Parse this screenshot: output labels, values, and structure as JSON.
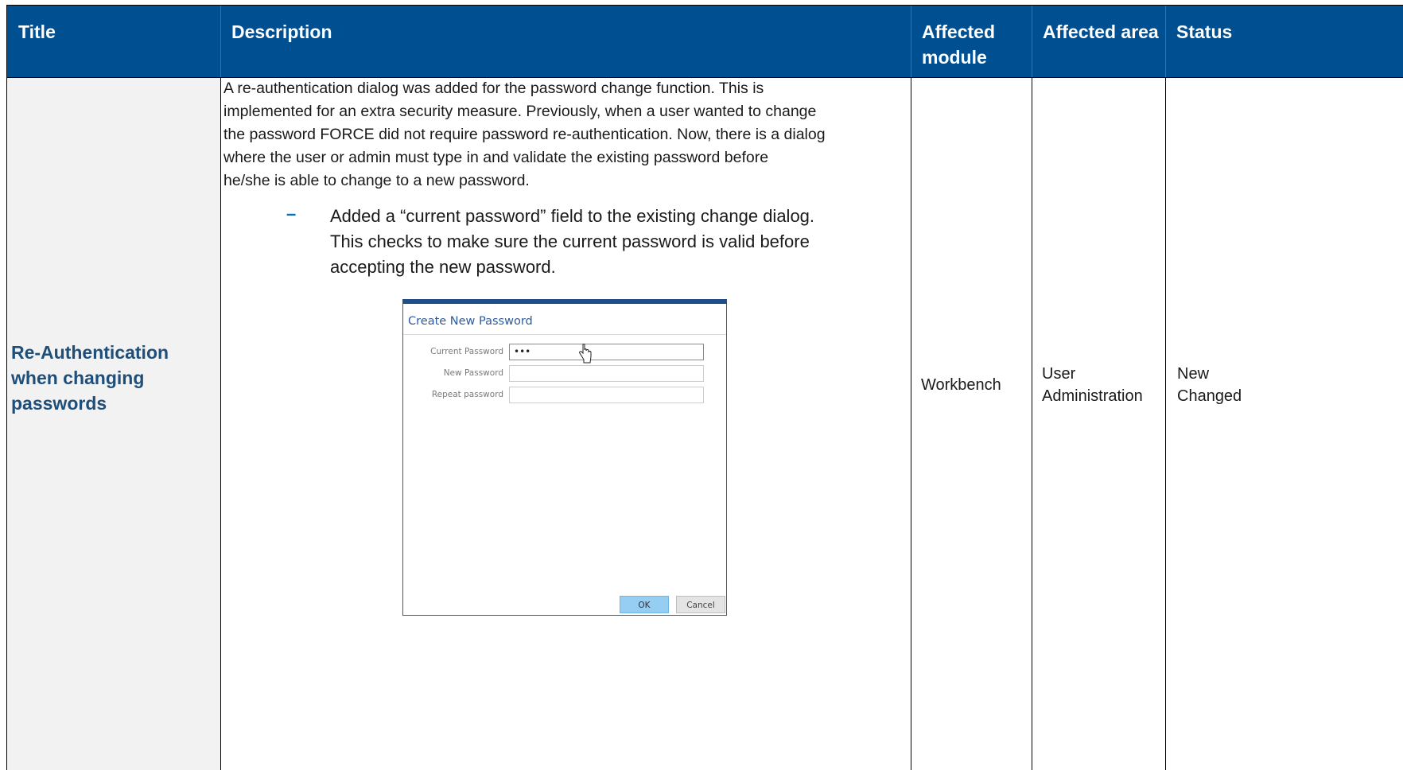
{
  "table": {
    "headers": {
      "title": "Title",
      "description": "Description",
      "affected_module": "Affected module",
      "affected_area": "Affected area",
      "status": "Status"
    },
    "row": {
      "title": "Re-Authentication when changing passwords",
      "description_lines": [
        "A re-authentication dialog was added for the password change function. This is",
        "implemented for an extra security measure. Previously, when a user wanted to change",
        "the password FORCE did not require password re-authentication. Now, there is a dialog",
        "where the user or admin must type in and validate the existing password before",
        "he/she is able to change to a new password."
      ],
      "bullet_dash": "–",
      "bullet_lines": [
        "Added a “current password” field to the existing change dialog.",
        "This checks to make sure the current password is valid before",
        "accepting the new password."
      ],
      "affected_module": "Workbench",
      "affected_area_lines": [
        "User",
        "Administration"
      ],
      "status_lines": [
        "New",
        "Changed"
      ]
    }
  },
  "dialog": {
    "title": "Create New Password",
    "fields": [
      {
        "label": "Current Password",
        "value": "•••"
      },
      {
        "label": "New Password",
        "value": ""
      },
      {
        "label": "Repeat password",
        "value": ""
      }
    ],
    "ok_label": "OK",
    "cancel_label": "Cancel",
    "cursor_icon": "hand-pointer-icon"
  },
  "colors": {
    "header_bg": "#004f91",
    "title_text": "#1f4e79",
    "bullet_dash": "#0070c0"
  }
}
